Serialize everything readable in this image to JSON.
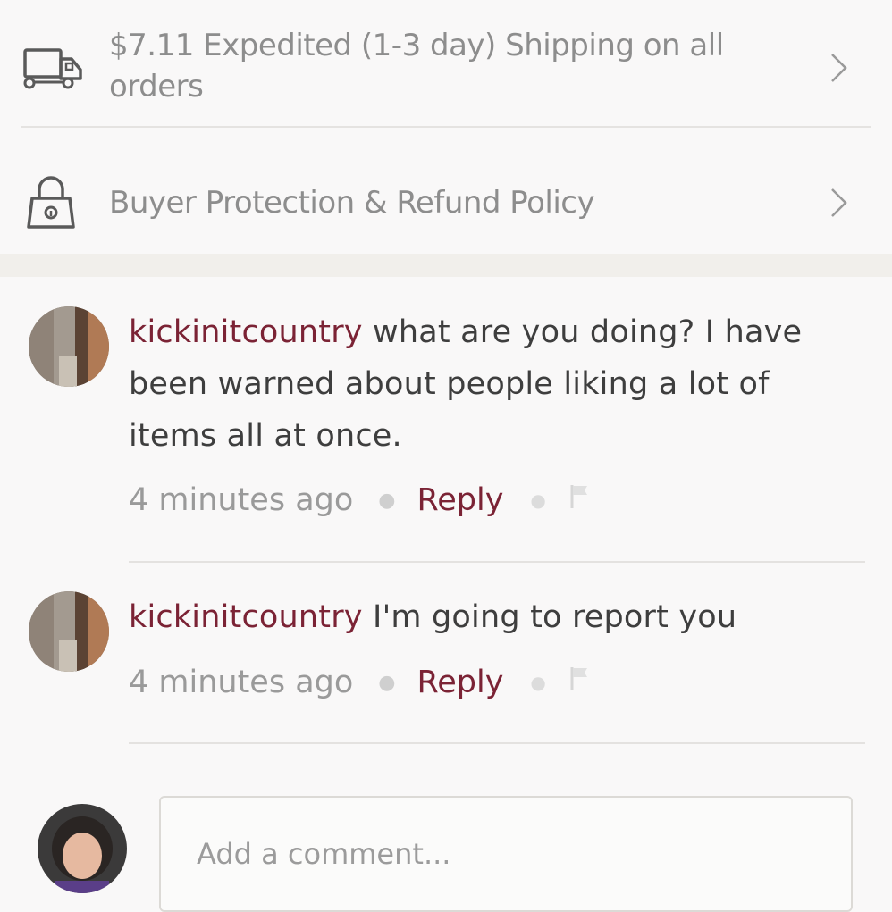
{
  "shipping": {
    "text": "$7.11 Expedited (1-3 day) Shipping on all orders",
    "icon": "truck-icon"
  },
  "buyer_protection": {
    "text": "Buyer Protection & Refund Policy",
    "icon": "lock-icon"
  },
  "comments": [
    {
      "username": "kickinitcountry",
      "text": "what are you doing? I have been warned about people liking a lot of items all at once.",
      "time": "4 minutes ago",
      "reply_label": "Reply"
    },
    {
      "username": "kickinitcountry",
      "text": "I'm going to report you",
      "time": "4 minutes ago",
      "reply_label": "Reply"
    }
  ],
  "comment_input": {
    "placeholder": "Add a comment..."
  },
  "colors": {
    "username": "#7b2335",
    "muted": "#8d8d8d",
    "background": "#f9f8f8"
  }
}
